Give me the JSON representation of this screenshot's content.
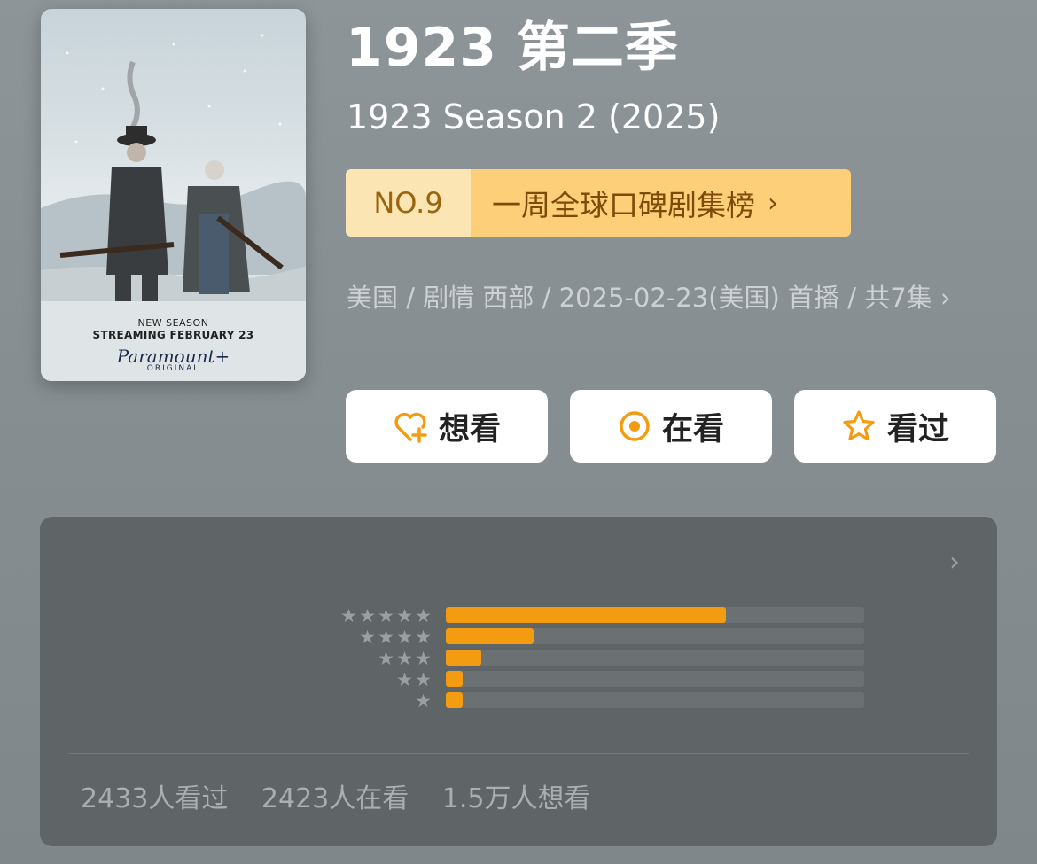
{
  "poster": {
    "new_season": "NEW SEASON",
    "streaming": "STREAMING FEBRUARY 23",
    "brand": "Paramount+",
    "original": "ORIGINAL"
  },
  "title_cn": "1923 第二季",
  "title_en": "1923 Season 2 (2025)",
  "ranking": {
    "number": "NO.9",
    "name": "一周全球口碑剧集榜",
    "chevron": "›"
  },
  "meta": {
    "text": "美国 / 剧情 西部 / 2025-02-23(美国) 首播 / 共7集",
    "chevron": "›"
  },
  "actions": [
    {
      "label": "想看",
      "icon": "heart-plus-icon"
    },
    {
      "label": "在看",
      "icon": "target-icon"
    },
    {
      "label": "看过",
      "icon": "star-outline-icon"
    }
  ],
  "rating": {
    "chevron": "›",
    "distribution": [
      {
        "stars": 5,
        "fraction": 0.67
      },
      {
        "stars": 4,
        "fraction": 0.21
      },
      {
        "stars": 3,
        "fraction": 0.085
      },
      {
        "stars": 2,
        "fraction": 0.04
      },
      {
        "stars": 1,
        "fraction": 0.04
      }
    ],
    "stats": {
      "watched": "2433人看过",
      "watching": "2423人在看",
      "want": "1.5万人想看"
    }
  },
  "colors": {
    "accent": "#f39c12",
    "rank_bg": "#fdcf78",
    "card_bg": "#5f6467"
  }
}
